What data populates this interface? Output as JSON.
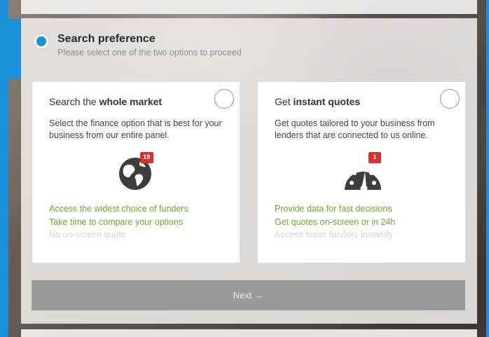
{
  "header": {
    "title": "Search preference",
    "subtitle": "Please select one of the two options to proceed"
  },
  "options": [
    {
      "title_prefix": "Search the ",
      "title_bold": "whole market",
      "description": "Select the finance option that is best for your business from our entire panel.",
      "icon": "globe-icon",
      "badge": "19",
      "pros": [
        "Access the widest choice of funders",
        "Take time to compare your options"
      ],
      "cons": [
        "No on-screen quote"
      ]
    },
    {
      "title_prefix": "Get ",
      "title_bold": "instant quotes",
      "description": "Get quotes tailored to your business from lenders that are connected to us online.",
      "icon": "speedometer-icon",
      "badge": "1",
      "pros": [
        "Provide data for fast decisions",
        "Get quotes on-screen or in 24h"
      ],
      "cons": [
        "Access fewer funders instantly"
      ]
    }
  ],
  "next_button": {
    "label": "Next",
    "arrow": "→"
  },
  "colors": {
    "accent": "#1b8fd8",
    "positive": "#6bac32",
    "muted": "#d6d6d6",
    "badge": "#d9302b",
    "button": "#9a9a9a"
  }
}
